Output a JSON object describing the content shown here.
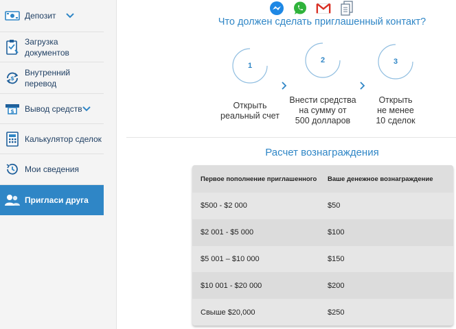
{
  "sidebar": {
    "items": [
      {
        "label": "Депозит",
        "icon": "money-icon",
        "has_chevron": true
      },
      {
        "label": "Загрузка документов",
        "icon": "document-upload-icon",
        "has_chevron": false
      },
      {
        "label": "Внутренний перевод",
        "icon": "transfer-icon",
        "has_chevron": false
      },
      {
        "label": "Вывод средств",
        "icon": "withdraw-icon",
        "has_chevron": true
      },
      {
        "label": "Калькулятор сделок",
        "icon": "calculator-icon",
        "has_chevron": false
      },
      {
        "label": "Мои сведения",
        "icon": "history-icon",
        "has_chevron": false
      },
      {
        "label": "Пригласи друга",
        "icon": "users-icon",
        "has_chevron": false,
        "active": true
      }
    ]
  },
  "share": {
    "icons": [
      "messenger-icon",
      "whatsapp-icon",
      "gmail-icon",
      "copy-icon"
    ]
  },
  "question": "Что должен сделать приглашенный контакт?",
  "steps": [
    {
      "num": "1",
      "line1": "Открыть",
      "line2": "реальный счет",
      "line3": ""
    },
    {
      "num": "2",
      "line1": "Внести средства",
      "line2": "на сумму от",
      "line3": "500 долларов"
    },
    {
      "num": "3",
      "line1": "Открыть",
      "line2": "не менее",
      "line3": "10 сделок"
    }
  ],
  "calc_title": "Расчет вознаграждения",
  "table": {
    "headers": [
      "Первое пополнение приглашенного",
      "Ваше денежное вознаграждение"
    ],
    "rows": [
      [
        "$500 - $2 000",
        "$50"
      ],
      [
        "$2 001 - $5 000",
        "$100"
      ],
      [
        "$5 001 – $10 000",
        "$150"
      ],
      [
        "$10 001 - $20 000",
        "$200"
      ],
      [
        "Свыше $20,000",
        "$250"
      ]
    ]
  },
  "colors": {
    "accent": "#2f86c6",
    "sidebar_text": "#1f3f63",
    "sidebar_bg": "#f4f4f4",
    "table_bg": "#dcdcdc"
  }
}
